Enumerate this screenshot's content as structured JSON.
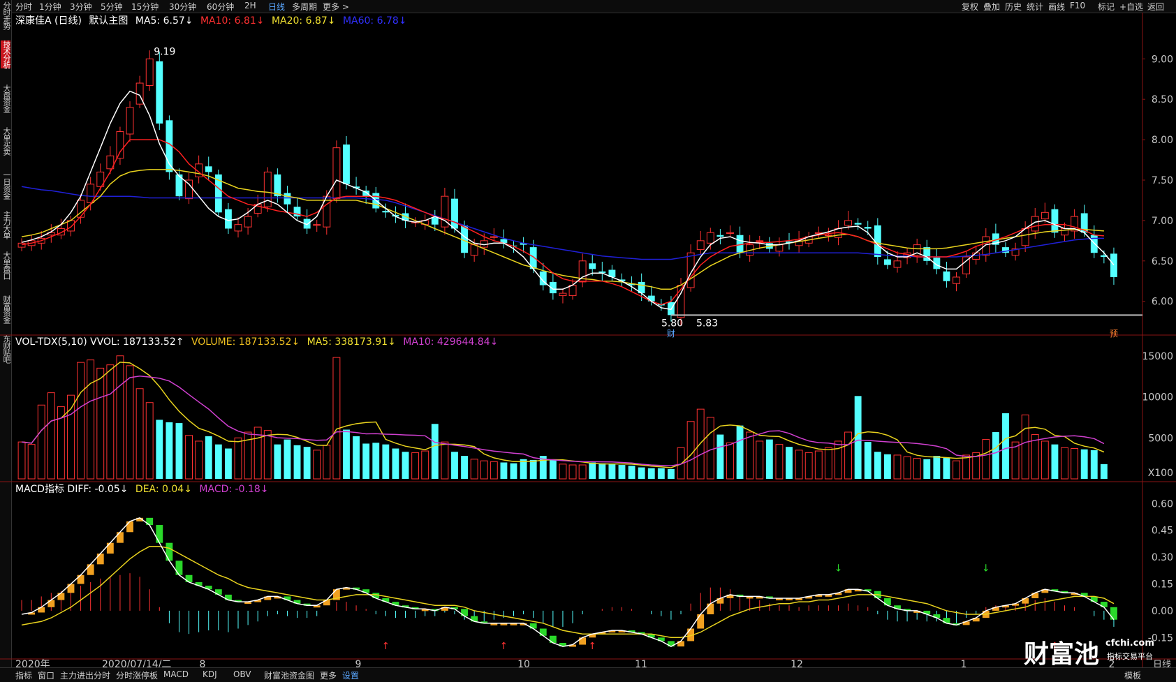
{
  "topbar": {
    "left_tabs": [
      "分时",
      "1分钟",
      "3分钟",
      "5分钟",
      "15分钟",
      "30分钟",
      "60分钟",
      "2H",
      "日线",
      "多周期",
      "更多 >"
    ],
    "active_tab": "日线",
    "right_tabs": [
      "复权",
      "叠加",
      "历史",
      "统计",
      "画线",
      "F10",
      "标记",
      "+自选",
      "返回"
    ]
  },
  "sidebar": {
    "items": [
      "分时走势",
      "技术分析",
      "大盘资金",
      "大单买卖",
      "一日资金",
      "主力大单",
      "大单盘口",
      "财富资金",
      "东财贴吧"
    ],
    "active": "技术分析"
  },
  "main_legend": {
    "stock": "深康佳A (日线)",
    "indicator": "默认主图",
    "ma5": "MA5: 6.57↓",
    "ma10": "MA10: 6.81↓",
    "ma20": "MA20: 6.87↓",
    "ma60": "MA60: 6.78↓"
  },
  "vol_legend": {
    "name": "VOL-TDX(5,10) VVOL: 187133.52↑",
    "volume": "VOLUME: 187133.52↓",
    "ma5": "MA5: 338173.91↓",
    "ma10": "MA10: 429644.84↓"
  },
  "macd_legend": {
    "name": "MACD指标 DIFF: -0.05↓",
    "dea": "DEA: 0.04↓",
    "macd": "MACD: -0.18↓"
  },
  "annotations": {
    "high": "9.19",
    "low_left": "5.80",
    "low_right": "5.83",
    "cai": "财",
    "yu": "预"
  },
  "x_axis": {
    "date_label": "2020年",
    "cursor_date": "2020/07/14/二",
    "months": [
      "8",
      "9",
      "10",
      "11",
      "12",
      "1",
      "2"
    ],
    "right_label": "日线"
  },
  "bottombar": {
    "items": [
      "指标",
      "窗口",
      "主力进出分时",
      "分时涨停板",
      "MACD",
      "KDJ",
      "OBV",
      "财富池资金图",
      "更多",
      "设置"
    ],
    "right": "模板"
  },
  "watermark": {
    "brand": "财富池",
    "site": "cfchi.com",
    "slogan": "指标交易平台"
  },
  "colors": {
    "up": "#ff3232",
    "down": "#54ffff",
    "ma5": "#ffffff",
    "ma10": "#ff2020",
    "ma20": "#e8d21e",
    "ma60": "#2020d8",
    "macd_up_bar": "#ff3232",
    "macd_dn_bar": "#54ffff",
    "orange": "#f0a020",
    "green": "#2ad82a"
  },
  "chart_data": [
    {
      "type": "candlestick",
      "title": "深康佳A (日线)",
      "y_ticks": [
        "9.00",
        "8.50",
        "8.00",
        "7.50",
        "7.00",
        "6.50",
        "6.00"
      ],
      "ylim": [
        5.6,
        9.4
      ],
      "close": [
        6.72,
        6.75,
        6.78,
        6.85,
        6.9,
        7.0,
        7.25,
        7.45,
        7.6,
        7.8,
        8.1,
        8.4,
        8.7,
        9.0,
        8.2,
        7.6,
        7.3,
        7.5,
        7.7,
        7.6,
        7.1,
        6.9,
        6.95,
        7.05,
        7.2,
        7.6,
        7.3,
        7.2,
        7.05,
        6.9,
        6.95,
        7.3,
        7.9,
        7.45,
        7.4,
        7.3,
        7.15,
        7.1,
        7.05,
        7.0,
        6.98,
        7.0,
        6.95,
        7.3,
        6.9,
        6.6,
        6.7,
        6.75,
        6.8,
        6.72,
        6.68,
        6.7,
        6.4,
        6.2,
        6.1,
        6.1,
        6.2,
        6.5,
        6.4,
        6.35,
        6.3,
        6.25,
        6.2,
        6.1,
        6.0,
        5.95,
        5.83,
        6.2,
        6.6,
        6.75,
        6.85,
        6.8,
        6.85,
        6.6,
        6.7,
        6.75,
        6.65,
        6.7,
        6.72,
        6.75,
        6.8,
        6.85,
        6.82,
        6.9,
        7.0,
        6.95,
        6.9,
        6.55,
        6.45,
        6.5,
        6.6,
        6.7,
        6.5,
        6.4,
        6.25,
        6.3,
        6.55,
        6.6,
        6.8,
        6.7,
        6.6,
        6.65,
        6.9,
        7.05,
        7.1,
        6.85,
        6.9,
        7.05,
        6.85,
        6.6,
        6.55,
        6.3
      ],
      "volume": [
        4500,
        4200,
        9000,
        10500,
        8800,
        10200,
        14200,
        14500,
        13500,
        13900,
        15000,
        13800,
        11000,
        9300,
        7200,
        6900,
        6800,
        5300,
        4600,
        5200,
        4200,
        3700,
        5000,
        5700,
        6300,
        5900,
        4200,
        4800,
        4100,
        3900,
        3500,
        4100,
        14800,
        6000,
        5200,
        4300,
        4400,
        4200,
        3700,
        3300,
        3200,
        3400,
        6700,
        4500,
        3300,
        2800,
        2400,
        2200,
        2100,
        2000,
        1900,
        2400,
        2300,
        2800,
        2300,
        1800,
        1700,
        1700,
        2000,
        1900,
        1800,
        1700,
        1600,
        1400,
        1300,
        1300,
        1200,
        3800,
        7000,
        8500,
        7500,
        5400,
        4400,
        6500,
        5700,
        4600,
        4800,
        4200,
        3900,
        3500,
        3200,
        3400,
        3800,
        4600,
        5700,
        10100,
        4500,
        3300,
        3000,
        2900,
        2700,
        2500,
        2400,
        2800,
        2600,
        2200,
        2900,
        3200,
        4800,
        5700,
        8000,
        4500,
        7800,
        5400,
        4600,
        4200,
        3800,
        3700,
        3600,
        3500,
        1800
      ],
      "ma5": [
        6.73,
        6.76,
        6.8,
        6.86,
        6.95,
        7.1,
        7.3,
        7.6,
        7.9,
        8.2,
        8.45,
        8.6,
        8.55,
        8.3,
        7.95,
        7.7,
        7.55,
        7.45,
        7.3,
        7.15,
        7.05,
        7.0,
        7.02,
        7.1,
        7.2,
        7.25,
        7.2,
        7.1,
        7.0,
        6.95,
        7.05,
        7.3,
        7.5,
        7.45,
        7.4,
        7.35,
        7.25,
        7.15,
        7.05,
        7.0,
        6.98,
        7.0,
        7.05,
        7.0,
        6.9,
        6.8,
        6.72,
        6.7,
        6.72,
        6.72,
        6.65,
        6.55,
        6.4,
        6.25,
        6.15,
        6.15,
        6.2,
        6.3,
        6.35,
        6.35,
        6.3,
        6.25,
        6.18,
        6.1,
        6.0,
        5.92,
        5.9,
        6.1,
        6.35,
        6.55,
        6.7,
        6.78,
        6.8,
        6.75,
        6.73,
        6.72,
        6.7,
        6.7,
        6.72,
        6.75,
        6.8,
        6.83,
        6.86,
        6.9,
        6.92,
        6.93,
        6.85,
        6.7,
        6.6,
        6.55,
        6.55,
        6.6,
        6.55,
        6.45,
        6.4,
        6.4,
        6.5,
        6.6,
        6.7,
        6.72,
        6.75,
        6.8,
        6.9,
        6.98,
        7.0,
        6.95,
        6.9,
        6.9,
        6.85,
        6.72,
        6.6,
        6.45
      ],
      "ma10": [
        6.7,
        6.72,
        6.75,
        6.8,
        6.85,
        6.92,
        7.05,
        7.2,
        7.4,
        7.6,
        7.85,
        8.0,
        8.0,
        8.0,
        8.0,
        7.95,
        7.85,
        7.7,
        7.6,
        7.5,
        7.4,
        7.3,
        7.25,
        7.2,
        7.18,
        7.15,
        7.12,
        7.1,
        7.08,
        7.05,
        7.1,
        7.2,
        7.28,
        7.3,
        7.3,
        7.3,
        7.3,
        7.28,
        7.25,
        7.2,
        7.15,
        7.1,
        7.05,
        7.02,
        6.98,
        6.92,
        6.86,
        6.8,
        6.75,
        6.72,
        6.68,
        6.62,
        6.55,
        6.45,
        6.35,
        6.28,
        6.25,
        6.25,
        6.25,
        6.25,
        6.22,
        6.18,
        6.12,
        6.06,
        6.0,
        5.96,
        6.0,
        6.15,
        6.3,
        6.45,
        6.55,
        6.62,
        6.68,
        6.7,
        6.72,
        6.73,
        6.73,
        6.74,
        6.75,
        6.77,
        6.8,
        6.82,
        6.84,
        6.85,
        6.83,
        6.8,
        6.75,
        6.7,
        6.65,
        6.6,
        6.58,
        6.55,
        6.55,
        6.55,
        6.55,
        6.58,
        6.62,
        6.68,
        6.72,
        6.76,
        6.8,
        6.85,
        6.9,
        6.93,
        6.95,
        6.95,
        6.95,
        6.92,
        6.88,
        6.82,
        6.81
      ],
      "ma20": [
        6.8,
        6.82,
        6.85,
        6.9,
        6.95,
        7.0,
        7.1,
        7.2,
        7.3,
        7.45,
        7.55,
        7.6,
        7.62,
        7.63,
        7.63,
        7.63,
        7.62,
        7.6,
        7.58,
        7.55,
        7.5,
        7.45,
        7.4,
        7.38,
        7.36,
        7.35,
        7.33,
        7.3,
        7.28,
        7.25,
        7.25,
        7.25,
        7.25,
        7.25,
        7.25,
        7.22,
        7.2,
        7.15,
        7.1,
        7.05,
        7.0,
        6.95,
        6.9,
        6.85,
        6.8,
        6.75,
        6.7,
        6.65,
        6.6,
        6.55,
        6.5,
        6.45,
        6.42,
        6.38,
        6.35,
        6.32,
        6.3,
        6.28,
        6.27,
        6.25,
        6.25,
        6.24,
        6.22,
        6.2,
        6.18,
        6.15,
        6.15,
        6.2,
        6.28,
        6.36,
        6.44,
        6.5,
        6.56,
        6.6,
        6.63,
        6.66,
        6.68,
        6.7,
        6.72,
        6.74,
        6.76,
        6.78,
        6.8,
        6.82,
        6.83,
        6.8,
        6.75,
        6.72,
        6.7,
        6.68,
        6.66,
        6.65,
        6.65,
        6.65,
        6.66,
        6.68,
        6.7,
        6.72,
        6.74,
        6.76,
        6.78,
        6.8,
        6.82,
        6.84,
        6.86,
        6.87,
        6.88,
        6.89,
        6.89,
        6.88,
        6.87
      ],
      "ma60": [
        7.42,
        7.4,
        7.38,
        7.37,
        7.35,
        7.33,
        7.31,
        7.3,
        7.3,
        7.3,
        7.3,
        7.3,
        7.29,
        7.28,
        7.28,
        7.28,
        7.28,
        7.28,
        7.28,
        7.28,
        7.28,
        7.28,
        7.28,
        7.28,
        7.28,
        7.28,
        7.28,
        7.28,
        7.28,
        7.28,
        7.28,
        7.28,
        7.28,
        7.28,
        7.28,
        7.27,
        7.26,
        7.25,
        7.22,
        7.18,
        7.14,
        7.1,
        7.06,
        7.02,
        6.98,
        6.94,
        6.9,
        6.86,
        6.82,
        6.78,
        6.75,
        6.72,
        6.7,
        6.68,
        6.66,
        6.64,
        6.62,
        6.6,
        6.58,
        6.56,
        6.55,
        6.54,
        6.53,
        6.52,
        6.52,
        6.52,
        6.52,
        6.54,
        6.56,
        6.58,
        6.6,
        6.6,
        6.6,
        6.6,
        6.6,
        6.6,
        6.6,
        6.6,
        6.6,
        6.6,
        6.6,
        6.6,
        6.6,
        6.6,
        6.6,
        6.6,
        6.59,
        6.58,
        6.57,
        6.56,
        6.56,
        6.55,
        6.55,
        6.55,
        6.55,
        6.55,
        6.56,
        6.57,
        6.58,
        6.6,
        6.62,
        6.64,
        6.66,
        6.68,
        6.7,
        6.72,
        6.74,
        6.76,
        6.77,
        6.78,
        6.78
      ]
    },
    {
      "type": "bar",
      "title": "VOL-TDX(5,10)",
      "y_ticks": [
        "15000",
        "10000",
        "5000"
      ],
      "unit_label": "X100",
      "ylim": [
        0,
        16000
      ]
    },
    {
      "type": "bar",
      "title": "MACD指标",
      "y_ticks": [
        "0.60",
        "0.45",
        "0.30",
        "0.15",
        "0.00",
        "-0.15"
      ],
      "ylim": [
        -0.27,
        0.66
      ],
      "diff": [
        -0.02,
        -0.01,
        0.02,
        0.06,
        0.1,
        0.15,
        0.2,
        0.26,
        0.32,
        0.38,
        0.44,
        0.5,
        0.52,
        0.48,
        0.38,
        0.28,
        0.2,
        0.16,
        0.14,
        0.12,
        0.09,
        0.06,
        0.05,
        0.05,
        0.06,
        0.08,
        0.08,
        0.06,
        0.04,
        0.03,
        0.03,
        0.06,
        0.12,
        0.13,
        0.12,
        0.1,
        0.07,
        0.05,
        0.03,
        0.02,
        0.01,
        0.01,
        0.0,
        0.02,
        0.01,
        -0.03,
        -0.06,
        -0.07,
        -0.07,
        -0.07,
        -0.07,
        -0.07,
        -0.1,
        -0.14,
        -0.18,
        -0.2,
        -0.19,
        -0.15,
        -0.13,
        -0.12,
        -0.11,
        -0.11,
        -0.12,
        -0.13,
        -0.15,
        -0.17,
        -0.2,
        -0.17,
        -0.1,
        -0.02,
        0.04,
        0.07,
        0.09,
        0.08,
        0.08,
        0.08,
        0.07,
        0.07,
        0.07,
        0.07,
        0.08,
        0.09,
        0.09,
        0.1,
        0.12,
        0.12,
        0.11,
        0.07,
        0.03,
        0.01,
        0.0,
        0.0,
        -0.02,
        -0.04,
        -0.07,
        -0.08,
        -0.06,
        -0.04,
        0.0,
        0.02,
        0.03,
        0.04,
        0.07,
        0.1,
        0.12,
        0.11,
        0.1,
        0.1,
        0.08,
        0.05,
        0.02,
        -0.05
      ],
      "dea": [
        -0.08,
        -0.07,
        -0.06,
        -0.04,
        -0.01,
        0.02,
        0.06,
        0.1,
        0.14,
        0.19,
        0.24,
        0.29,
        0.33,
        0.36,
        0.36,
        0.35,
        0.32,
        0.29,
        0.26,
        0.23,
        0.2,
        0.18,
        0.15,
        0.13,
        0.12,
        0.11,
        0.1,
        0.09,
        0.08,
        0.07,
        0.06,
        0.06,
        0.07,
        0.08,
        0.09,
        0.09,
        0.09,
        0.08,
        0.07,
        0.06,
        0.05,
        0.04,
        0.03,
        0.03,
        0.03,
        0.02,
        0.0,
        -0.01,
        -0.02,
        -0.03,
        -0.04,
        -0.05,
        -0.06,
        -0.07,
        -0.09,
        -0.11,
        -0.12,
        -0.13,
        -0.13,
        -0.13,
        -0.13,
        -0.13,
        -0.13,
        -0.13,
        -0.13,
        -0.14,
        -0.15,
        -0.15,
        -0.14,
        -0.12,
        -0.09,
        -0.06,
        -0.03,
        -0.01,
        0.01,
        0.02,
        0.03,
        0.04,
        0.04,
        0.05,
        0.05,
        0.06,
        0.06,
        0.07,
        0.08,
        0.09,
        0.09,
        0.09,
        0.08,
        0.07,
        0.06,
        0.05,
        0.04,
        0.02,
        0.0,
        -0.01,
        -0.02,
        -0.02,
        -0.02,
        -0.01,
        0.0,
        0.01,
        0.02,
        0.04,
        0.05,
        0.06,
        0.07,
        0.08,
        0.08,
        0.08,
        0.07,
        0.04
      ],
      "macd": [
        0.12,
        0.12,
        0.16,
        0.2,
        0.22,
        0.26,
        0.28,
        0.32,
        0.36,
        0.38,
        0.4,
        0.42,
        0.38,
        0.24,
        0.04,
        -0.14,
        -0.24,
        -0.26,
        -0.24,
        -0.22,
        -0.22,
        -0.24,
        -0.2,
        -0.16,
        -0.12,
        -0.06,
        -0.04,
        -0.06,
        -0.08,
        -0.08,
        -0.06,
        0.0,
        0.1,
        0.1,
        0.06,
        0.02,
        -0.04,
        -0.06,
        -0.08,
        -0.08,
        -0.08,
        -0.06,
        -0.06,
        -0.02,
        -0.04,
        -0.1,
        -0.12,
        -0.12,
        -0.1,
        -0.08,
        -0.06,
        -0.04,
        -0.08,
        -0.14,
        -0.18,
        -0.18,
        -0.14,
        -0.04,
        0.0,
        0.02,
        0.04,
        0.04,
        0.02,
        0.0,
        -0.04,
        -0.06,
        -0.1,
        -0.04,
        0.08,
        0.2,
        0.26,
        0.26,
        0.24,
        0.18,
        0.14,
        0.12,
        0.08,
        0.06,
        0.06,
        0.04,
        0.06,
        0.06,
        0.06,
        0.06,
        0.08,
        0.06,
        0.04,
        -0.04,
        -0.1,
        -0.12,
        -0.12,
        -0.1,
        -0.12,
        -0.12,
        -0.14,
        -0.14,
        -0.08,
        -0.04,
        0.04,
        0.06,
        0.06,
        0.06,
        0.1,
        0.12,
        0.14,
        0.1,
        0.06,
        0.04,
        0.0,
        -0.06,
        -0.1,
        -0.18
      ]
    }
  ]
}
